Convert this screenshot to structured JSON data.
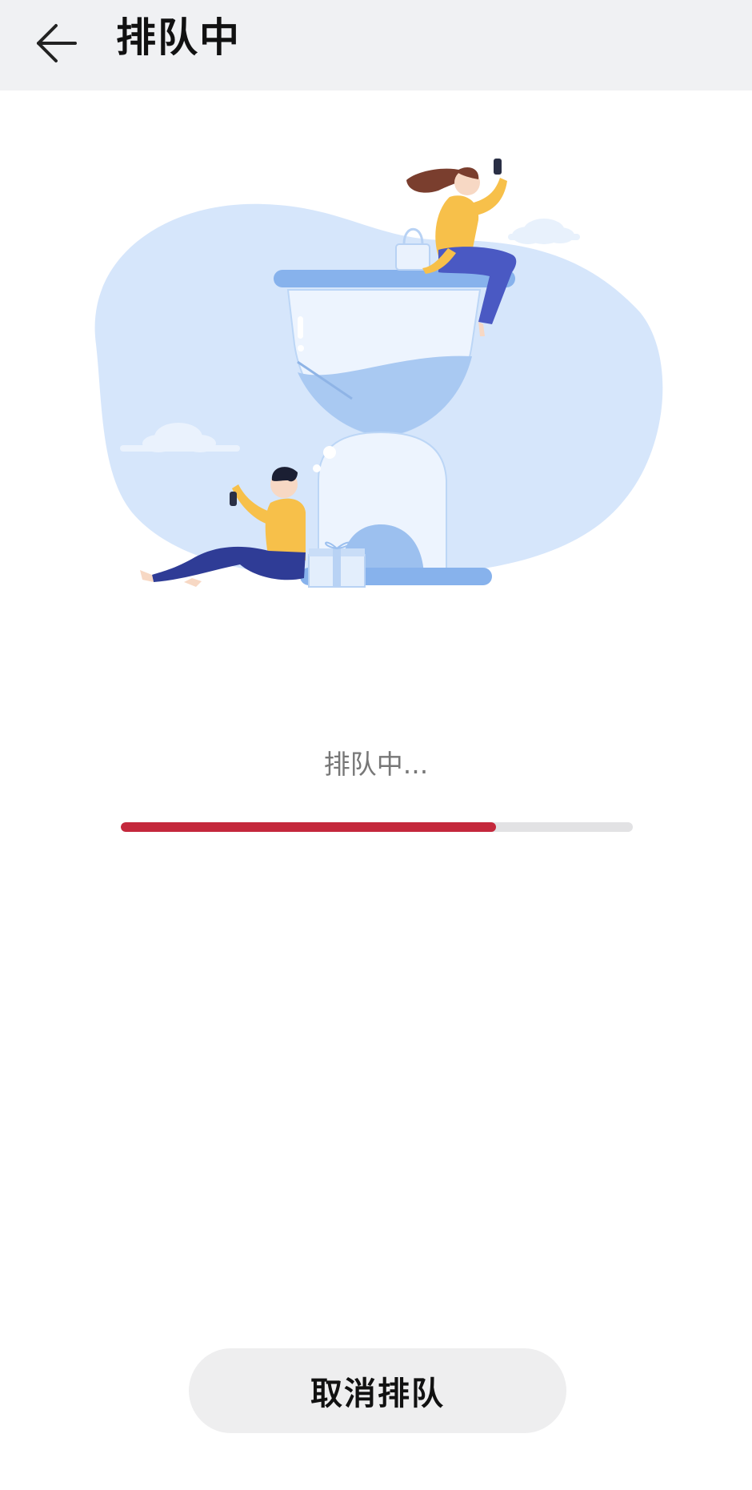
{
  "header": {
    "title": "排队中",
    "back_icon": "arrow-left-icon"
  },
  "main": {
    "illustration": "queue-hourglass-illustration",
    "status_text": "排队中...",
    "progress": 0.733,
    "progress_color": "#c4283c",
    "progress_track_color": "#e2e2e4"
  },
  "footer": {
    "cancel_label": "取消排队"
  }
}
